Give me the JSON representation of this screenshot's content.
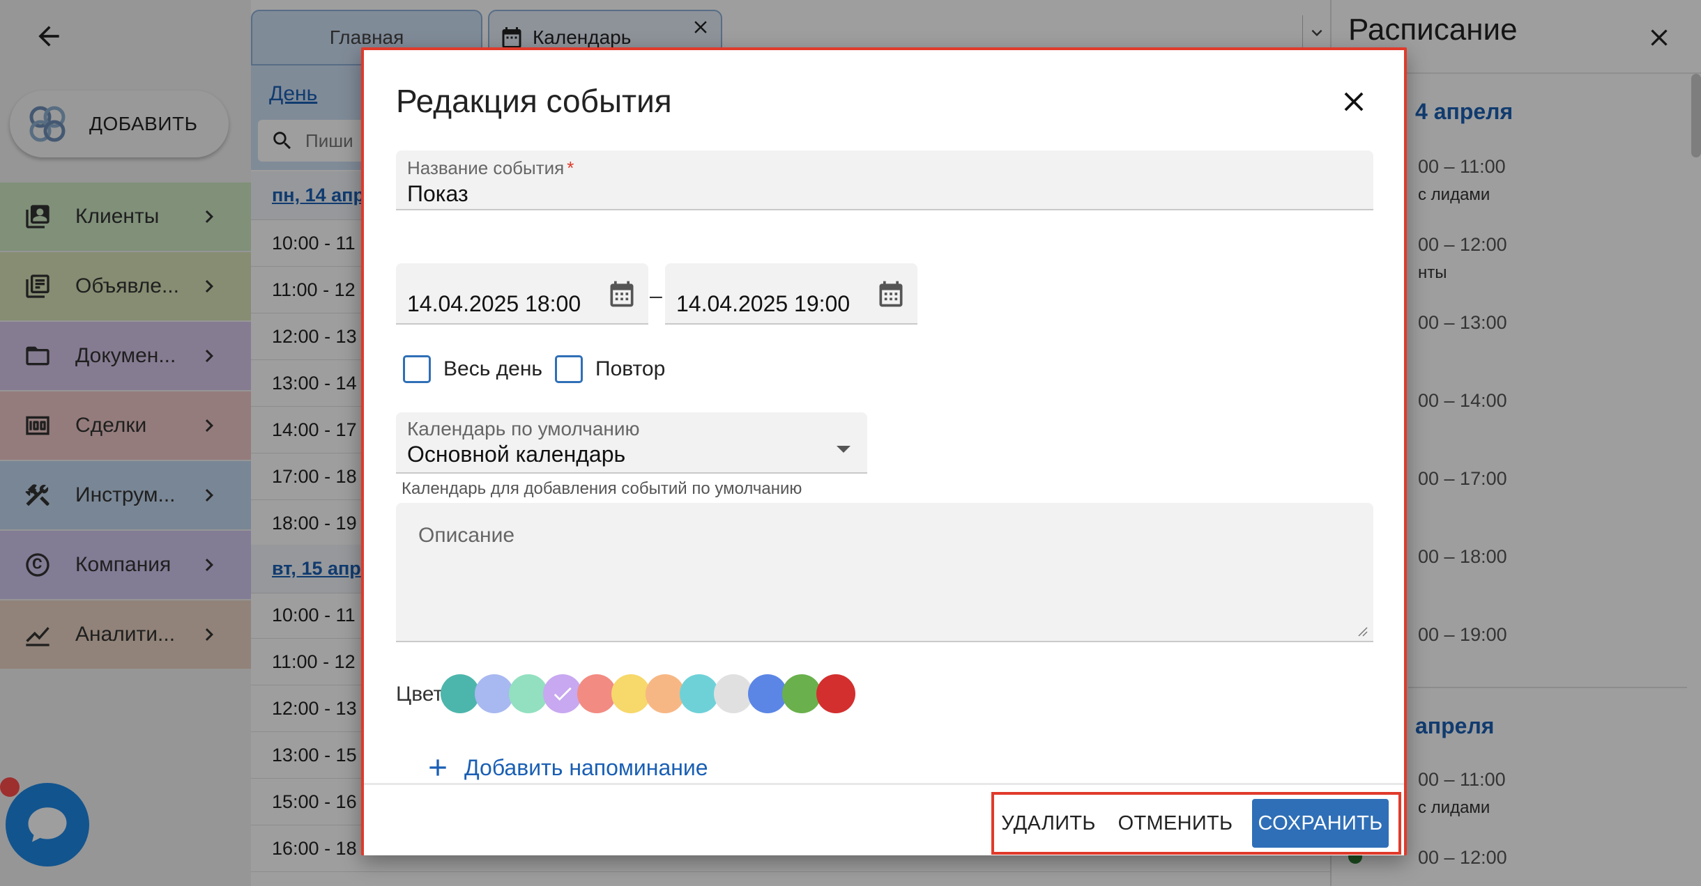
{
  "sidebar": {
    "add_label": "ДОБАВИТЬ",
    "items": [
      {
        "label": "Клиенты",
        "color": "#cfe8c4"
      },
      {
        "label": "Объявле...",
        "color": "#d8e4b8"
      },
      {
        "label": "Докумен...",
        "color": "#d8c8ec"
      },
      {
        "label": "Сделки",
        "color": "#f0c8c8"
      },
      {
        "label": "Инструм...",
        "color": "#c4d8f0"
      },
      {
        "label": "Компания",
        "color": "#d4c8f0"
      },
      {
        "label": "Аналити...",
        "color": "#ead4c4"
      }
    ]
  },
  "tabs": {
    "main_label": "Главная",
    "calendar_label": "Календарь"
  },
  "calendar_view": {
    "day_link": "День",
    "search_placeholder": "Пиши",
    "days": [
      {
        "header": "пн, 14 апр",
        "slots": [
          "10:00 - 11",
          "11:00 - 12",
          "12:00 - 13",
          "13:00 - 14",
          "14:00 - 17",
          "17:00 - 18",
          "18:00 - 19"
        ]
      },
      {
        "header": "вт, 15 апр",
        "slots": [
          "10:00 - 11",
          "11:00 - 12",
          "12:00 - 13",
          "13:00 - 15",
          "15:00 - 16",
          "16:00 - 18"
        ]
      }
    ]
  },
  "schedule": {
    "title": "Расписание",
    "date1": "4 апреля",
    "entries1": [
      {
        "time": "00 – 11:00",
        "sub": "с лидами"
      },
      {
        "time": "00 – 12:00",
        "sub": "нты"
      },
      {
        "time": "00 – 13:00",
        "sub": ""
      },
      {
        "time": "00 – 14:00",
        "sub": ""
      },
      {
        "time": "00 – 17:00",
        "sub": ""
      },
      {
        "time": "00 – 18:00",
        "sub": ""
      },
      {
        "time": "00 – 19:00",
        "sub": ""
      }
    ],
    "date2": "апреля",
    "entries2": [
      {
        "time": "00 – 11:00",
        "sub": "с лидами"
      },
      {
        "time": "00 – 12:00",
        "sub": ""
      }
    ]
  },
  "dialog": {
    "title": "Редакция события",
    "name_label": "Название события",
    "name_required_mark": "*",
    "name_value": "Показ",
    "start_value": "14.04.2025 18:00",
    "end_value": "14.04.2025 19:00",
    "range_separator": "–",
    "all_day_label": "Весь день",
    "repeat_label": "Повтор",
    "calendar_label": "Календарь по умолчанию",
    "calendar_value": "Основной календарь",
    "calendar_hint": "Календарь для добавления событий по умолчанию",
    "description_placeholder": "Описание",
    "color_label": "Цвет:",
    "colors": [
      "#4db6ac",
      "#a8b8f0",
      "#92e0c0",
      "#c8a8f0",
      "#f28b82",
      "#f6d86b",
      "#f7b784",
      "#6fd1d8",
      "#e0e0e0",
      "#5b86e5",
      "#6ab04c",
      "#d32f2f"
    ],
    "selected_color_index": 3,
    "add_reminder_label": "Добавить напоминание",
    "delete_label": "УДАЛИТЬ",
    "cancel_label": "ОТМЕНИТЬ",
    "save_label": "СОХРАНИТЬ"
  }
}
